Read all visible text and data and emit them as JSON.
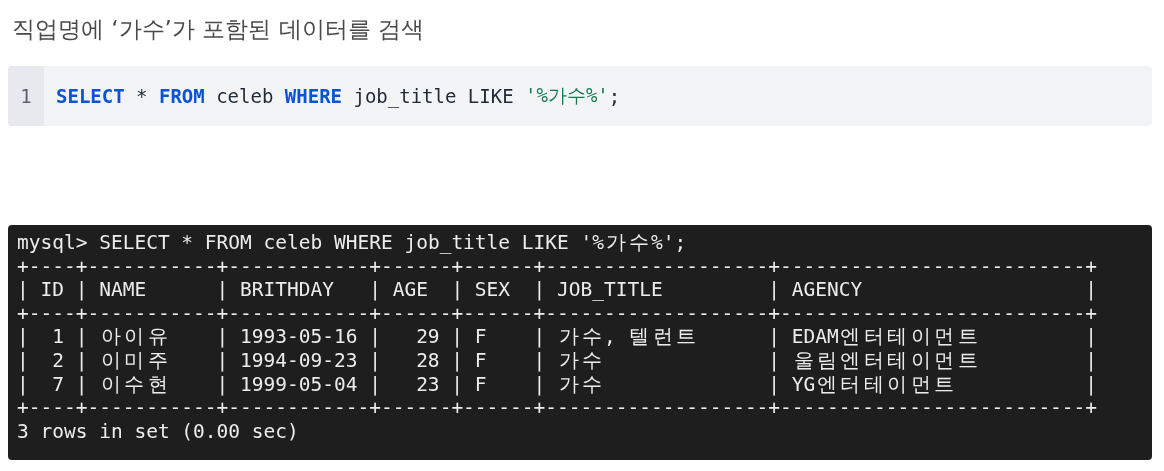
{
  "heading": "직업명에 ‘가수’가 포함된 데이터를 검색",
  "code_block": {
    "line_number": "1",
    "tokens": [
      {
        "kind": "keyword",
        "text": "SELECT"
      },
      {
        "kind": "plain",
        "text": " * "
      },
      {
        "kind": "keyword",
        "text": "FROM"
      },
      {
        "kind": "plain",
        "text": " celeb "
      },
      {
        "kind": "keyword",
        "text": "WHERE"
      },
      {
        "kind": "plain",
        "text": " job_title LIKE "
      },
      {
        "kind": "string",
        "text": "'%가수%'"
      },
      {
        "kind": "plain",
        "text": ";"
      }
    ]
  },
  "terminal": {
    "lines": [
      "mysql> SELECT * FROM celeb WHERE job_title LIKE '%가수%';",
      "+----+-----------+------------+------+------+-------------------+--------------------------+",
      "| ID | NAME      | BRITHDAY   | AGE  | SEX  | JOB_TITLE         | AGENCY                   |",
      "+----+-----------+------------+------+------+-------------------+--------------------------+",
      "|  1 | 아이유    | 1993-05-16 |   29 | F    | 가수, 텔런트      | EDAM엔터테이먼트         |",
      "|  2 | 이미주    | 1994-09-23 |   28 | F    | 가수              | 울림엔터테이먼트         |",
      "|  7 | 이수현    | 1999-05-04 |   23 | F    | 가수              | YG엔터테이먼트           |",
      "+----+-----------+------------+------+------+-------------------+--------------------------+",
      "3 rows in set (0.00 sec)"
    ]
  }
}
